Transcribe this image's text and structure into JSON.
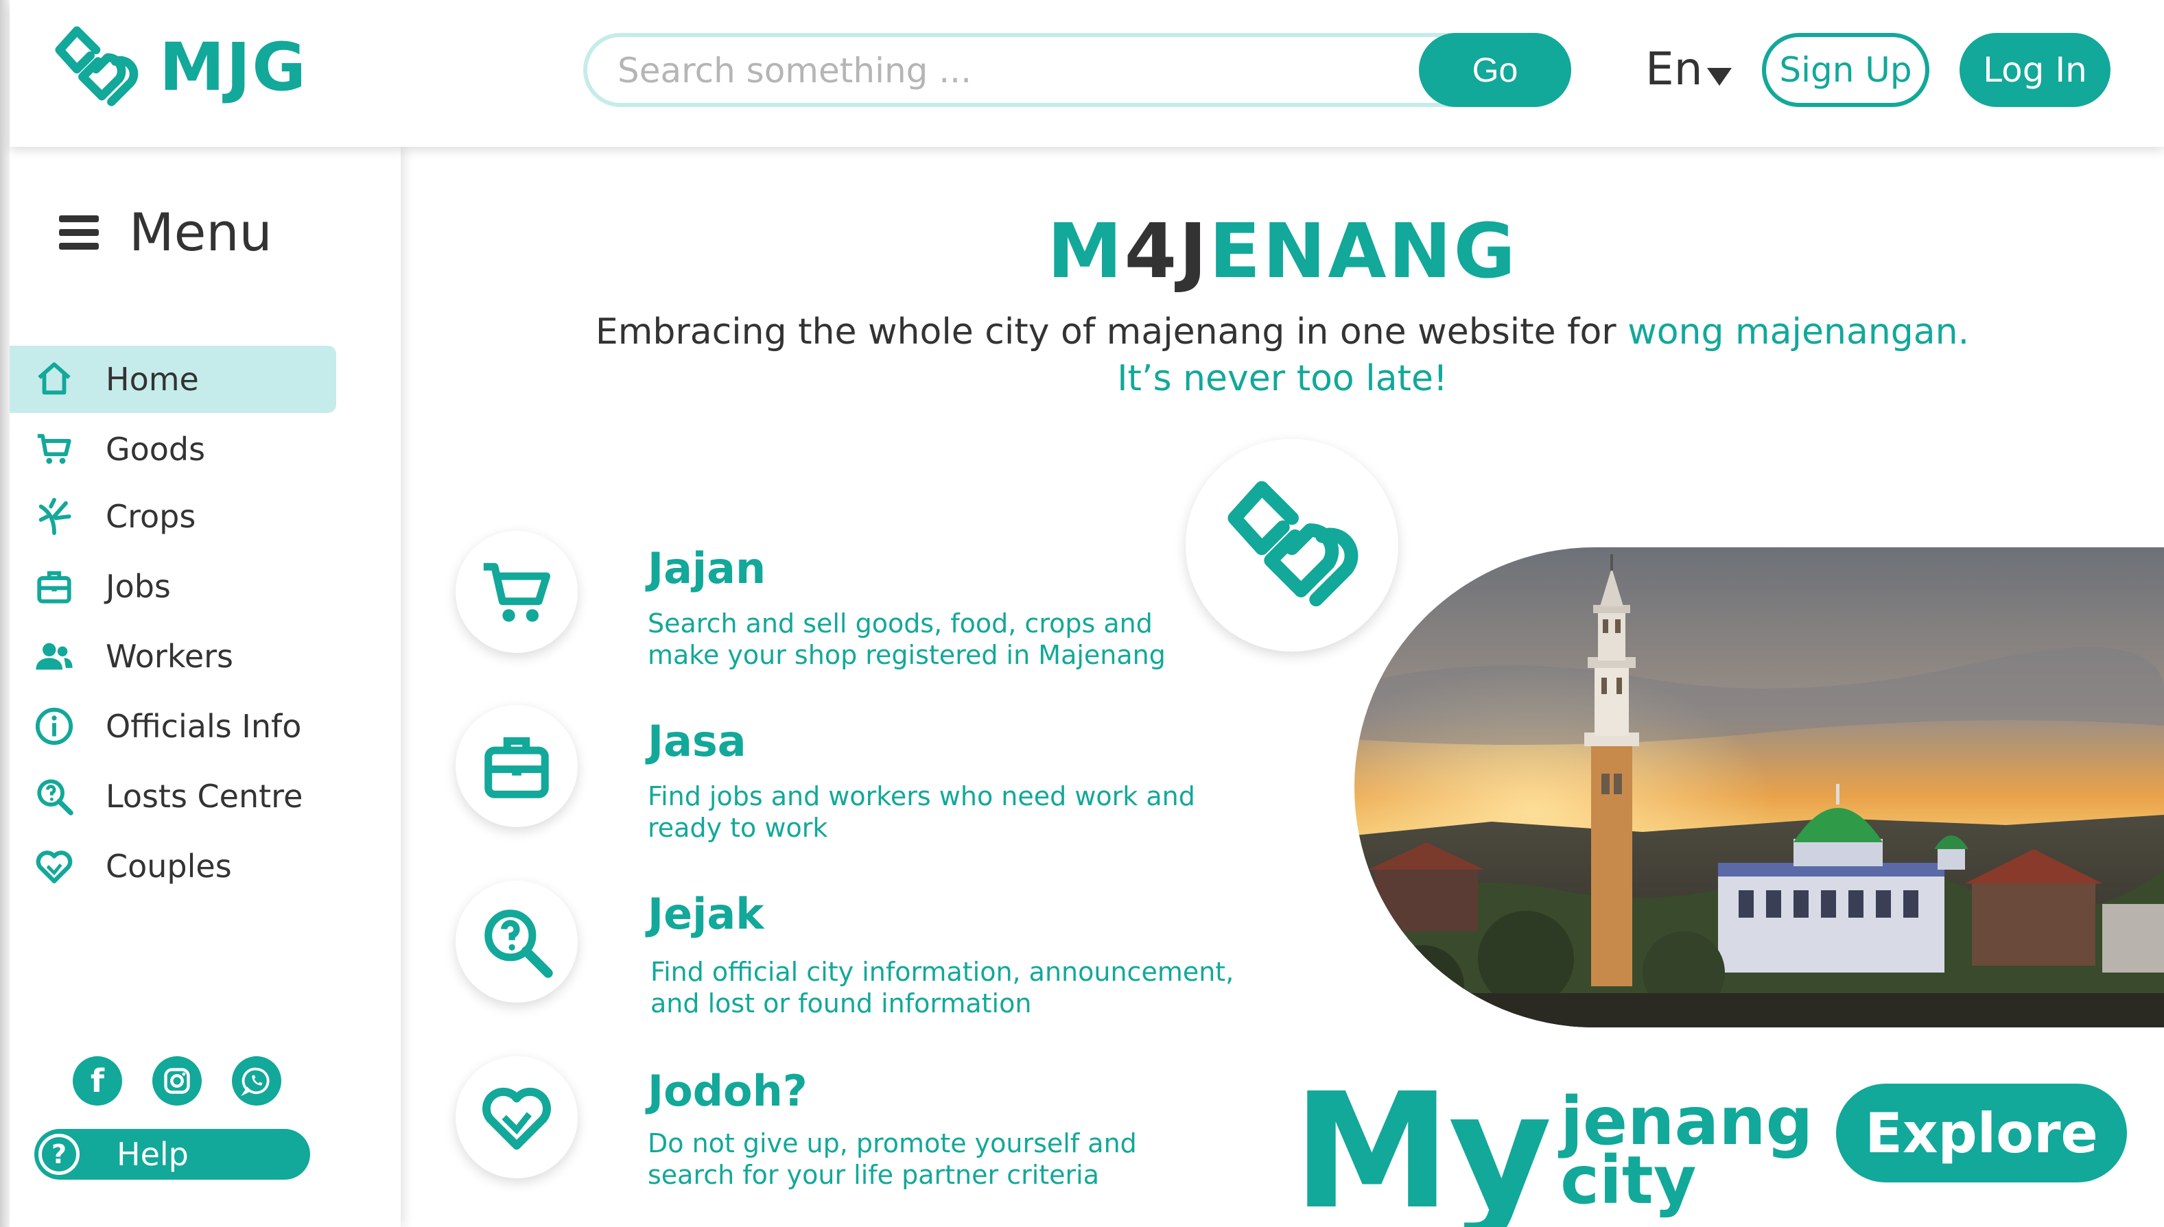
{
  "colors": {
    "accent": "#12a89a",
    "accent_light": "#c5ecea",
    "text_dark": "#333333"
  },
  "header": {
    "logo_text": "MJG",
    "search": {
      "placeholder": "Search something ...",
      "go_label": "Go"
    },
    "language": "En",
    "signup_label": "Sign Up",
    "login_label": "Log In"
  },
  "sidebar": {
    "menu_title": "Menu",
    "items": [
      {
        "label": "Home",
        "icon": "home-icon",
        "active": true
      },
      {
        "label": "Goods",
        "icon": "cart-icon",
        "active": false
      },
      {
        "label": "Crops",
        "icon": "sprout-icon",
        "active": false
      },
      {
        "label": "Jobs",
        "icon": "briefcase-icon",
        "active": false
      },
      {
        "label": "Workers",
        "icon": "people-icon",
        "active": false
      },
      {
        "label": "Officials Info",
        "icon": "info-icon",
        "active": false
      },
      {
        "label": "Losts Centre",
        "icon": "search-question-icon",
        "active": false
      },
      {
        "label": "Couples",
        "icon": "heart-icon",
        "active": false
      }
    ],
    "socials": [
      "facebook-icon",
      "instagram-icon",
      "whatsapp-icon"
    ],
    "help_label": "Help"
  },
  "main": {
    "brand_part1": "M",
    "brand_part2": "4J",
    "brand_part3": "ENANG",
    "tagline_dark": "Embracing the whole city of majenang in one website for ",
    "tagline_teal": "wong majenangan.",
    "tagline_line2": "It’s never too late!",
    "services": [
      {
        "title": "Jajan",
        "icon": "cart-icon",
        "desc_line1": "Search and sell goods, food, crops and",
        "desc_line2": "make your shop registered in Majenang"
      },
      {
        "title": "Jasa",
        "icon": "briefcase-icon",
        "desc_line1": "Find jobs and workers who need work and",
        "desc_line2": "ready to work"
      },
      {
        "title": "Jejak",
        "icon": "search-question-icon",
        "desc_line1": "Find official city information, announcement,",
        "desc_line2": "and lost or found information"
      },
      {
        "title": "Jodoh?",
        "icon": "heart-icon",
        "desc_line1": "Do not give up, promote yourself and",
        "desc_line2": "search for your life partner criteria"
      }
    ],
    "hero_alt": "Majenang mosque at sunset",
    "city_my": "My",
    "city_line1": "jenang",
    "city_line2": "city",
    "explore_label": "Explore"
  }
}
